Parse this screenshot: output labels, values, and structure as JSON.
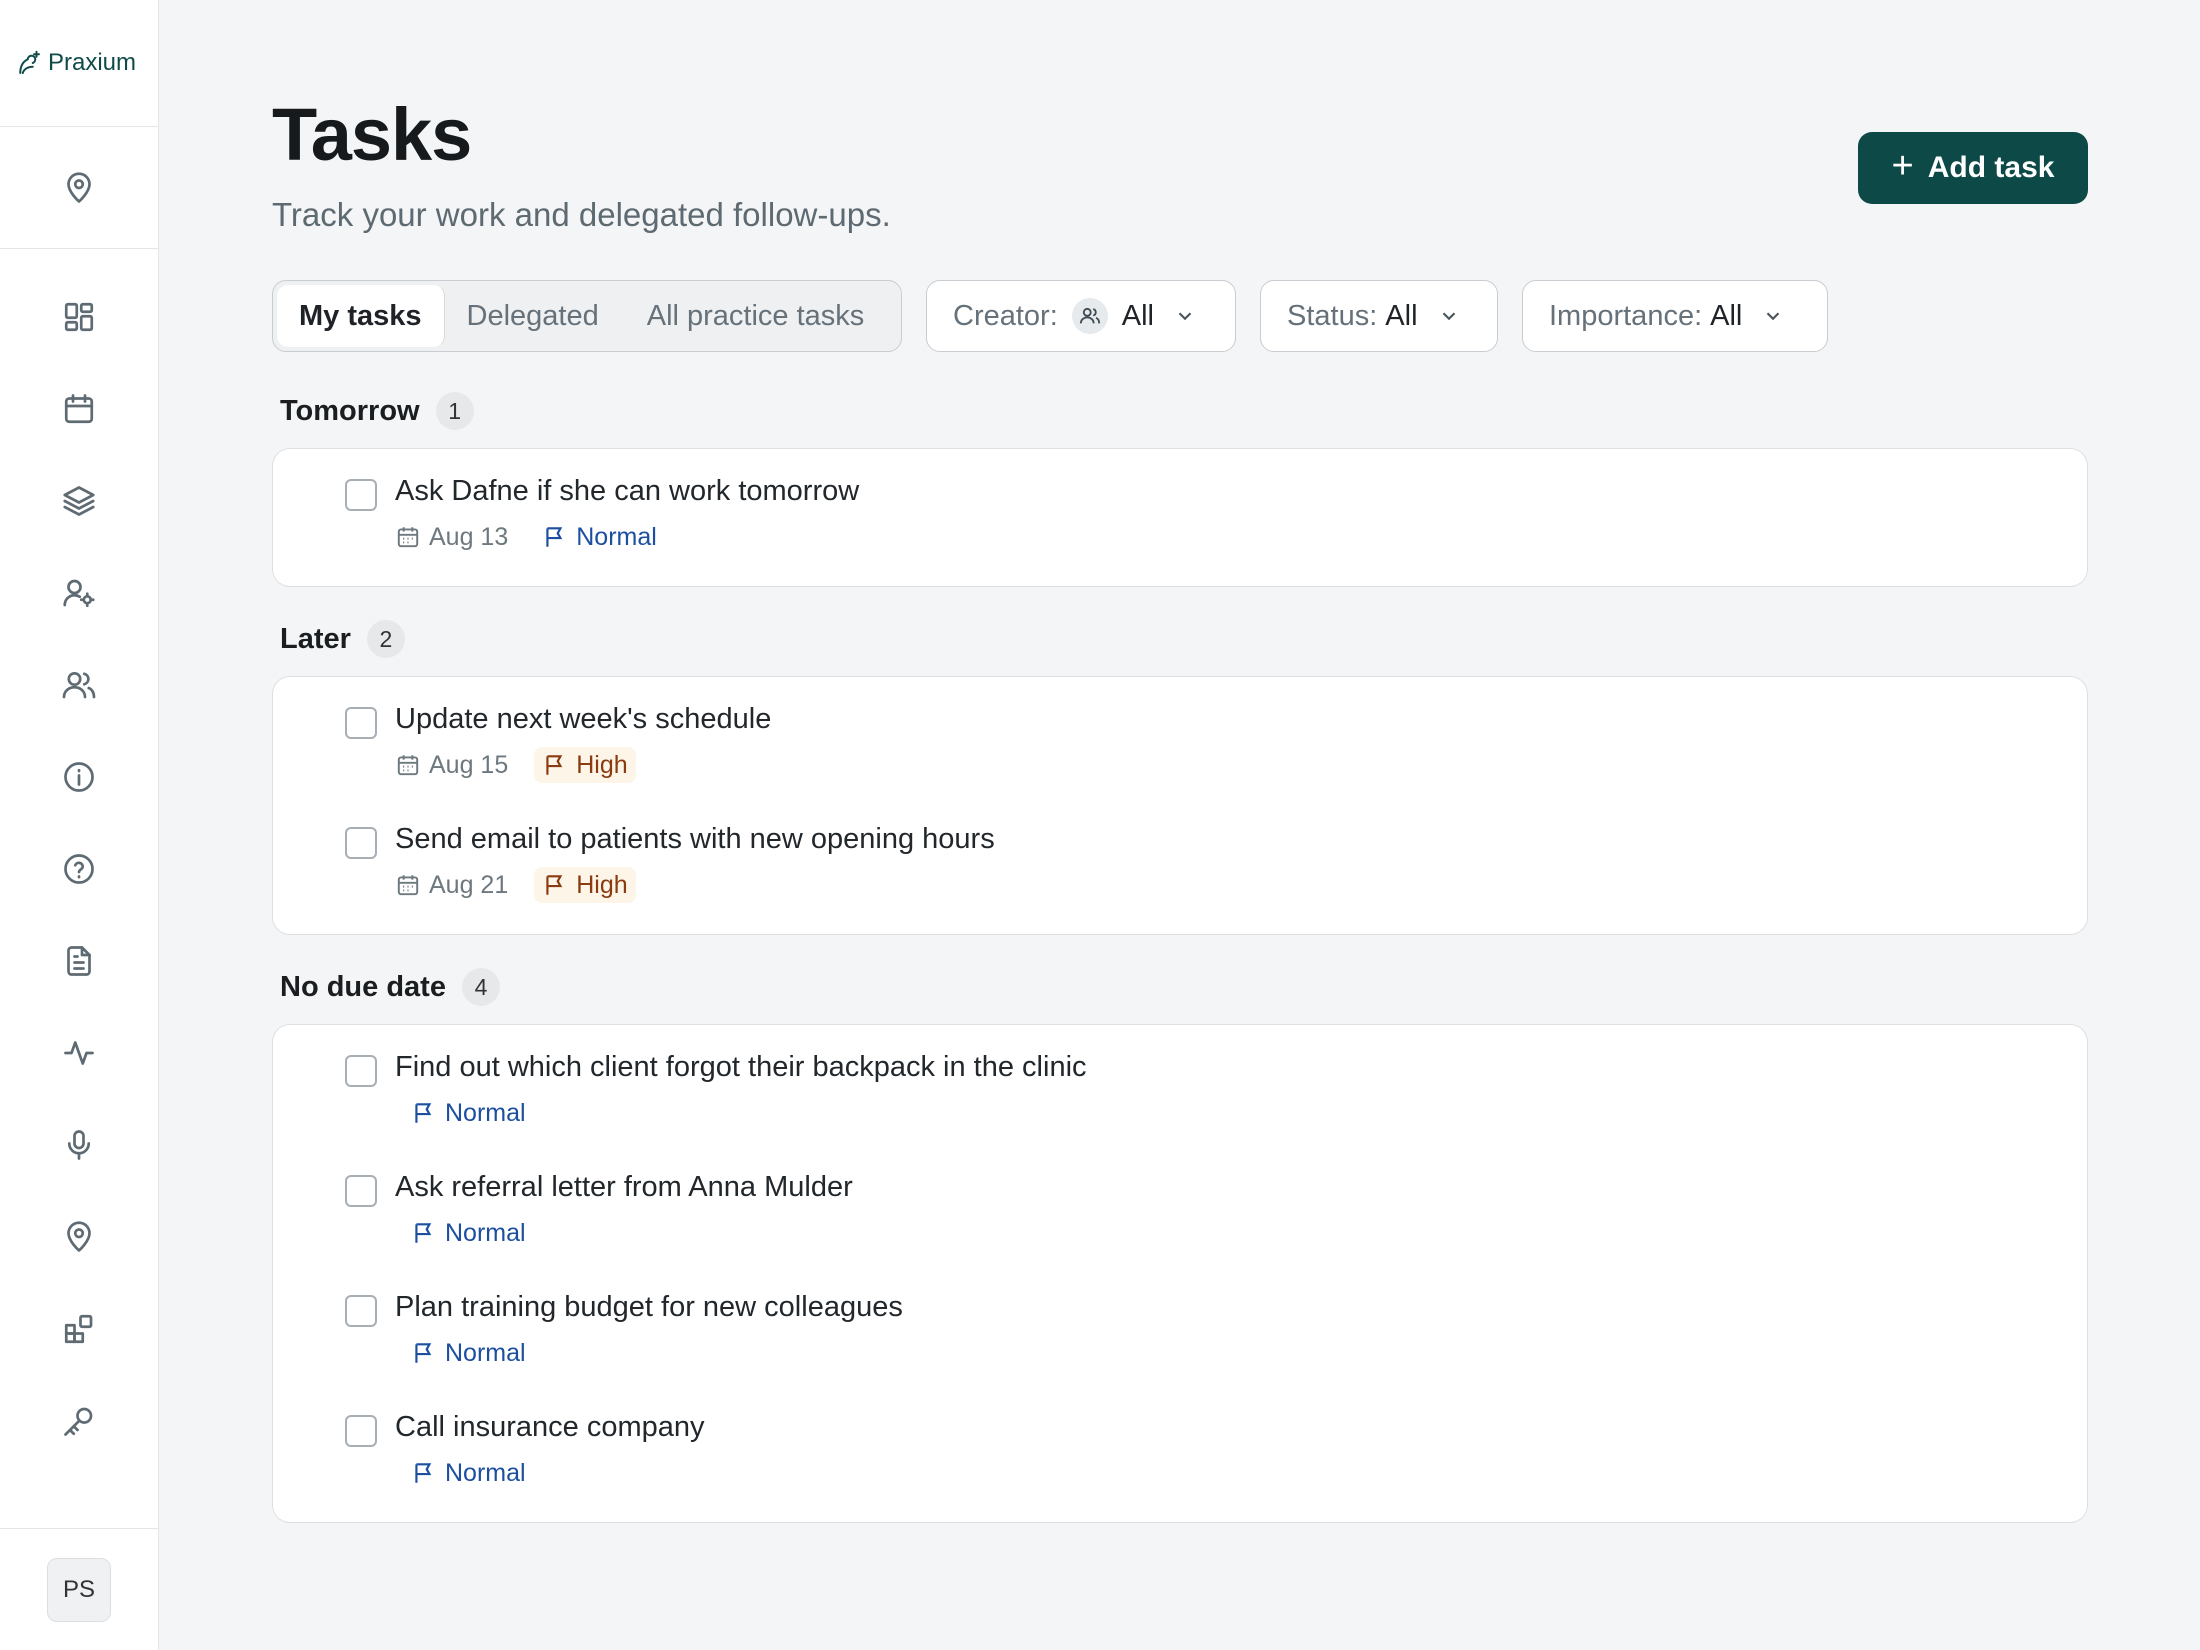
{
  "brand": {
    "name": "Praxium"
  },
  "sidebar": {
    "top_icon": "location-pin-icon",
    "items": [
      {
        "icon": "dashboard-icon"
      },
      {
        "icon": "calendar-icon"
      },
      {
        "icon": "layers-icon"
      },
      {
        "icon": "user-settings-icon"
      },
      {
        "icon": "users-icon"
      },
      {
        "icon": "info-icon"
      },
      {
        "icon": "help-icon"
      },
      {
        "icon": "document-icon"
      },
      {
        "icon": "activity-icon"
      },
      {
        "icon": "microphone-icon"
      },
      {
        "icon": "location-pin-icon"
      },
      {
        "icon": "widgets-icon"
      },
      {
        "icon": "key-icon"
      }
    ],
    "user_initials": "PS"
  },
  "header": {
    "title": "Tasks",
    "subtitle": "Track your work and delegated follow-ups.",
    "add_label": "Add task"
  },
  "filters": {
    "tabs": [
      "My tasks",
      "Delegated",
      "All practice tasks"
    ],
    "active_tab": "My tasks",
    "creator_label": "Creator:",
    "creator_value": "All",
    "status_label": "Status:",
    "status_value": "All",
    "importance_label": "Importance:",
    "importance_value": "All"
  },
  "groups": [
    {
      "title": "Tomorrow",
      "count": "1",
      "tasks": [
        {
          "title": "Ask Dafne if she can work tomorrow",
          "date": "Aug 13",
          "priority": "Normal"
        }
      ]
    },
    {
      "title": "Later",
      "count": "2",
      "tasks": [
        {
          "title": "Update next week's schedule",
          "date": "Aug 15",
          "priority": "High"
        },
        {
          "title": "Send email to patients with new opening hours",
          "date": "Aug 21",
          "priority": "High"
        }
      ]
    },
    {
      "title": "No due date",
      "count": "4",
      "tasks": [
        {
          "title": "Find out which client forgot their backpack in the clinic",
          "priority": "Normal"
        },
        {
          "title": "Ask referral letter from Anna Mulder",
          "priority": "Normal"
        },
        {
          "title": "Plan training budget for new colleagues",
          "priority": "Normal"
        },
        {
          "title": "Call insurance company",
          "priority": "Normal"
        }
      ]
    }
  ],
  "colors": {
    "brand": "#0d4a47",
    "priority_normal": "#1d4fa0",
    "priority_high": "#8a3b0f",
    "priority_high_bg": "#fdf5e7"
  }
}
